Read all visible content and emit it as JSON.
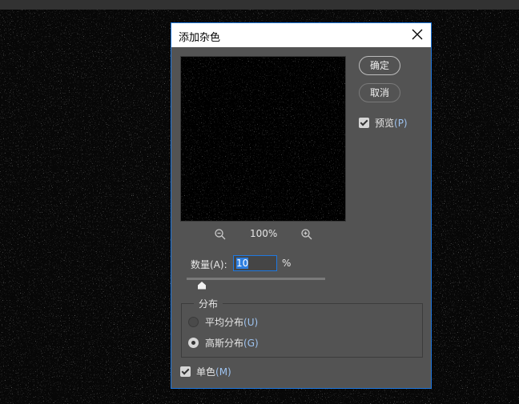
{
  "dialog": {
    "title": "添加杂色",
    "ok_label": "确定",
    "cancel_label": "取消",
    "preview_label": "预览",
    "preview_key": "(P)",
    "preview_checked": true,
    "zoom_level": "100%",
    "amount": {
      "label": "数量(A):",
      "value": "10",
      "unit": "%",
      "slider_value": 10,
      "slider_max": 400
    },
    "distribution": {
      "legend": "分布",
      "options": [
        {
          "label": "平均分布",
          "key": "(U)",
          "selected": false
        },
        {
          "label": "高斯分布",
          "key": "(G)",
          "selected": true
        }
      ]
    },
    "monochromatic": {
      "label": "单色",
      "key": "(M)",
      "checked": true
    }
  },
  "colors": {
    "accent": "#1e78e0",
    "panel": "#535353"
  }
}
